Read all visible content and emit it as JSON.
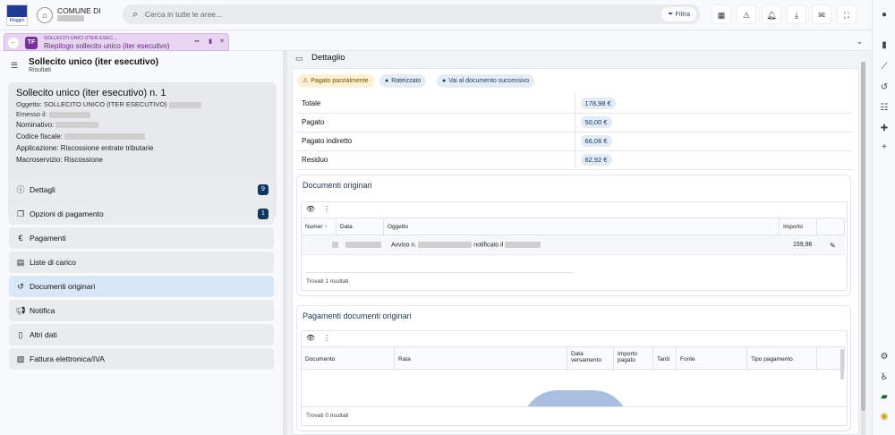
{
  "topbar": {
    "logo_text": "Maggiò",
    "comune_label": "COMUNE DI",
    "search_placeholder": "Cerca in tutte le aree...",
    "filter_label": "Filtra",
    "icons": [
      "dashboard-icon",
      "warning-icon",
      "bell-icon",
      "download-icon",
      "mail-icon",
      "fullscreen-icon"
    ]
  },
  "tab": {
    "badge": "TF",
    "kicker": "SOLLECITI UNICI (ITER ESEC...",
    "title": "Riepilogo sollecito unico (iter esecutivo)"
  },
  "left": {
    "title": "Sollecito unico (iter esecutivo)",
    "subtitle": "Risultati",
    "card": {
      "title": "Sollecito unico (iter esecutivo) n. 1",
      "oggetto_label": "Oggetto: SOLLECITO UNICO (ITER ESECUTIVO)",
      "emesso_label": "Emesso il:",
      "nominativo_label": "Nominativo:",
      "codice_fiscale_label": "Codice fiscale:",
      "applicazione": "Applicazione: Riscossione entrate tributarie",
      "macroservizio": "Macroservizio: Riscossione"
    },
    "menu": [
      {
        "label": "Dettagli",
        "icon": "info-icon",
        "count": "9"
      },
      {
        "label": "Opzioni di pagamento",
        "icon": "document-copy-icon",
        "count": "1"
      },
      {
        "label": "Pagamenti",
        "icon": "euro-icon",
        "count": ""
      },
      {
        "label": "Liste di carico",
        "icon": "clipboard-icon",
        "count": ""
      },
      {
        "label": "Documenti originari",
        "icon": "history-icon",
        "count": ""
      },
      {
        "label": "Notifica",
        "icon": "megaphone-icon",
        "count": ""
      },
      {
        "label": "Altri dati",
        "icon": "document-icon",
        "count": ""
      },
      {
        "label": "Fattura elettronica/IVA",
        "icon": "invoice-icon",
        "count": ""
      }
    ]
  },
  "main": {
    "title": "Dettaglio",
    "chips": {
      "status": "Pagato parzialmente",
      "rate": "Rateizzato",
      "next": "Vai al documento successivo"
    },
    "summary": [
      {
        "label": "Totale",
        "value": "178,98 €"
      },
      {
        "label": "Pagato",
        "value": "50,00 €"
      },
      {
        "label": "Pagato indiretto",
        "value": "66,06 €"
      },
      {
        "label": "Residuo",
        "value": "62,92 €"
      }
    ],
    "docs": {
      "title": "Documenti originari",
      "headers": {
        "numero": "Numer",
        "data": "Data",
        "oggetto": "Oggetto",
        "importo": "Importo"
      },
      "row": {
        "oggetto_prefix": "Avviso n.",
        "oggetto_mid": "notificato il",
        "importo": "159,96"
      },
      "footer": "Trovati 1 risultati"
    },
    "payments": {
      "title": "Pagamenti documenti originari",
      "headers": {
        "documento": "Documento",
        "rata": "Rata",
        "data_versamento_1": "Data",
        "data_versamento_2": "versamento",
        "importo_pagato_1": "Importo",
        "importo_pagato_2": "pagato",
        "tardi": "Tardi",
        "fonte": "Fonte",
        "tipo_pagamento": "Tipo pagamento"
      },
      "footer": "Trovati 0 risultati"
    }
  },
  "colors": {
    "accent": "#7b2f9d",
    "navy": "#10365f",
    "warning_bg": "#fdf0d5",
    "info_bg": "#e4ecf5"
  }
}
